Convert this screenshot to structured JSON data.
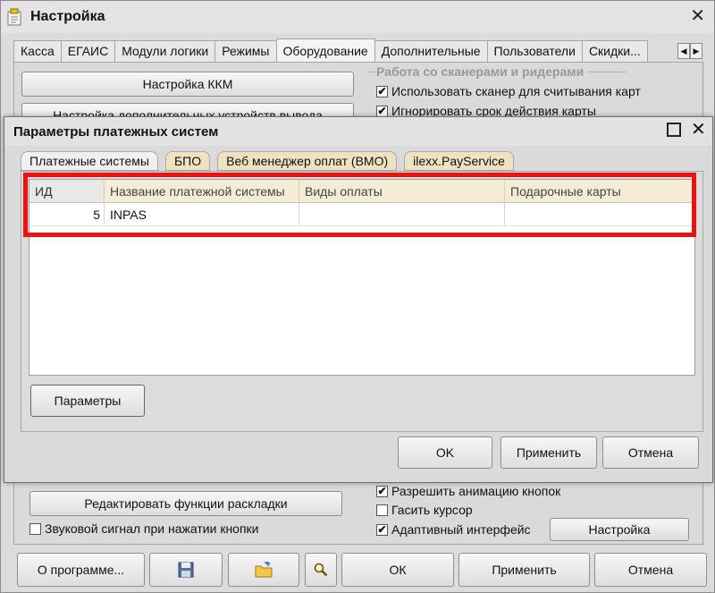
{
  "outer": {
    "title": "Настройка",
    "tabs": [
      "Касса",
      "ЕГАИС",
      "Модули логики",
      "Режимы",
      "Оборудование",
      "Дополнительные",
      "Пользователи",
      "Скидки..."
    ],
    "active_tab": "Оборудование",
    "buttons": {
      "kkm": "Настройка ККМ",
      "extra_devices": "Настройка дополнительных устройств вывода",
      "edit_layout": "Редактировать функции раскладки",
      "settings": "Настройка",
      "about": "О программе...",
      "ok": "ОК",
      "apply": "Применить",
      "cancel": "Отмена"
    },
    "scan_group": {
      "title": "Работа со сканерами и ридерами",
      "options": [
        {
          "label": "Использовать сканер для считывания карт",
          "checked": true
        },
        {
          "label": "Игнорировать срок действия карты",
          "checked": true
        }
      ]
    },
    "bottom_checks": [
      {
        "label": "Разрешить анимацию кнопок",
        "checked": true
      },
      {
        "label": "Гасить курсор",
        "checked": false
      },
      {
        "label": "Адаптивный интерфейс",
        "checked": true
      }
    ],
    "sound_check": {
      "label": "Звуковой сигнал при нажатии кнопки",
      "checked": false
    }
  },
  "dialog": {
    "title": "Параметры платежных систем",
    "tabs": [
      "Платежные системы",
      "БПО",
      "Веб менеджер оплат (ВМО)",
      "ilexx.PayService"
    ],
    "active_tab": "Платежные системы",
    "grid": {
      "columns": [
        "ИД",
        "Название платежной системы",
        "Виды оплаты",
        "Подарочные карты"
      ],
      "rows": [
        [
          "5",
          "INPAS",
          "",
          ""
        ]
      ]
    },
    "buttons": {
      "params": "Параметры",
      "ok": "OK",
      "apply": "Применить",
      "cancel": "Отмена"
    }
  },
  "colors": {
    "highlight": "#ee1111",
    "grid_header": "#f4ecd5",
    "dialog_tab": "#efe2c0"
  }
}
